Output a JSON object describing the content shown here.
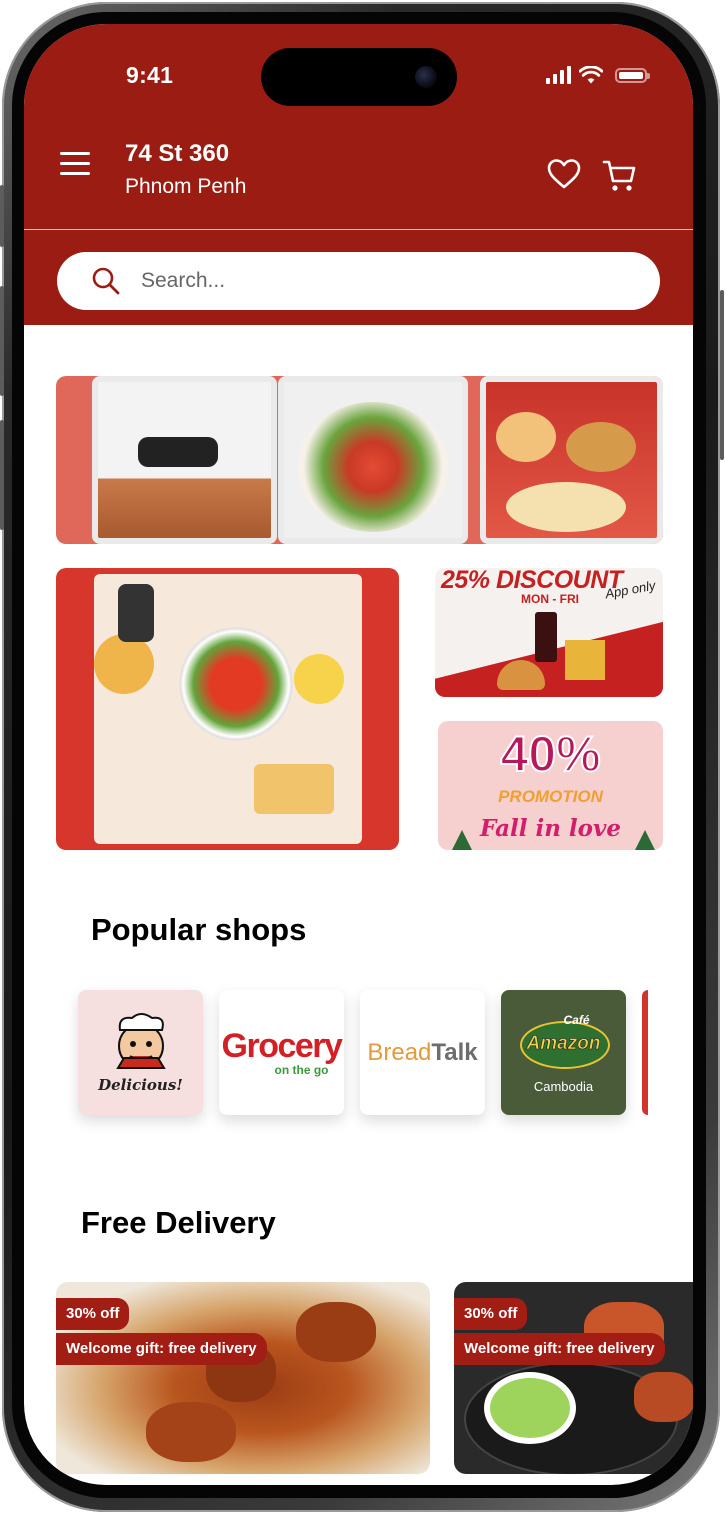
{
  "status_bar": {
    "time": "9:41"
  },
  "header": {
    "location_street": "74 St 360",
    "location_city": "Phnom Penh"
  },
  "search": {
    "placeholder": "Search..."
  },
  "banners": {
    "discount_text": "25% DISCOUNT",
    "discount_days": "MON - FRI",
    "discount_app_note": "App only",
    "promo_percent": "40%",
    "promo_label": "PROMOTION",
    "promo_tagline": "Fall in love"
  },
  "popular_shops": {
    "title": "Popular shops",
    "shops": [
      {
        "name": "Delicious!"
      },
      {
        "name_part1": "Grocery",
        "name_part2": "on the go"
      },
      {
        "name_part1": "Bread",
        "name_part2": "Talk"
      },
      {
        "name_part1": "Café",
        "name_part2": "Amazon",
        "name_part3": "Cambodia"
      }
    ]
  },
  "free_delivery": {
    "title": "Free Delivery",
    "cards": [
      {
        "discount": "30% off",
        "gift": "Welcome gift: free delivery"
      },
      {
        "discount": "30% off",
        "gift": "Welcome gift: free delivery"
      }
    ]
  },
  "colors": {
    "brand": "#9b1c13",
    "tag": "#a21d14",
    "amazon_green": "#4a5b3a"
  }
}
